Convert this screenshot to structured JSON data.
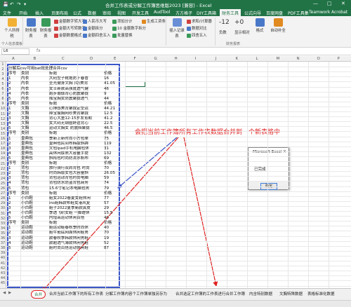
{
  "window": {
    "title": "合并工作表或分解工作簿思维版2023 [兼容] - Excel",
    "controls": [
      "—",
      "□",
      "✕"
    ]
  },
  "qat": [
    "💾",
    "↶",
    "↷",
    "▾"
  ],
  "ribbon_tabs": [
    "文件",
    "开始",
    "插入",
    "页面布局",
    "公式",
    "数据",
    "审阅",
    "视图",
    "开发工具",
    "AudTool",
    "方方格子",
    "DIY工具箱",
    "财务工具",
    "公式向导",
    "百度网盘",
    "PDF工具集",
    "Teamwork",
    "Acrobat",
    "WPS",
    "搜索"
  ],
  "ribbon": {
    "group1": {
      "label": "个人信息模板",
      "big": "个人所得税"
    },
    "group2_big": [
      "财务报表",
      "财务报表"
    ],
    "group2_small": [
      "金额数字转大写",
      "金额大写转数字",
      "金额数据格式"
    ],
    "group3_small": [
      "人民币大写",
      "金额拆分",
      "金额四舍五入"
    ],
    "group4_small": [
      "添加分计",
      "10 金额数字拆分",
      "批量替换"
    ],
    "group5_small": [
      "生成工资条",
      "",
      ""
    ],
    "group6_small": [
      "求和/计算器",
      "数据对比",
      "四舍五入"
    ],
    "group6_big": "插入记录表",
    "group7": [
      "-12",
      "+0",
      "负数",
      "显示相对"
    ],
    "group7_label": "财务报表",
    "group8": [
      "格式",
      "自动补全"
    ]
  },
  "formula_bar": {
    "name_box": "L6",
    "content": ""
  },
  "columns": [
    "A",
    "B",
    "C",
    "D",
    "E",
    "F",
    "G",
    "H",
    "I",
    "J",
    "K",
    "L",
    "M",
    "N",
    "O",
    "P",
    "Q",
    "R",
    "S"
  ],
  "row_numbers": [
    "1",
    "2",
    "3",
    "4",
    "5",
    "6",
    "7",
    "8",
    "9",
    "10",
    "11",
    "12",
    "13",
    "14",
    "15",
    "16",
    "17",
    "18",
    "19",
    "20",
    "21",
    "22",
    "23",
    "24",
    "25",
    "26",
    "27",
    "28",
    "29",
    "30",
    "31",
    "32",
    "33",
    "34",
    "35",
    "36",
    "37",
    "38",
    "39",
    "40",
    "41",
    "42",
    "43",
    "44",
    "45"
  ],
  "sheet_rows": [
    [
      "",
      "",
      "",
      ""
    ],
    [
      "分解后csv可用bat批处理合并csv",
      "",
      "",
      ""
    ],
    [
      "序号",
      "类别",
      "标题",
      "价格"
    ],
    [
      "1",
      "内衣",
      "大码型子靴拖防下春冒",
      "16"
    ],
    [
      "2",
      "内衣",
      "圣光健身文胸 (Q)美背",
      "41.05"
    ],
    [
      "3",
      "内衣",
      "女士新款高强度透气健",
      "46"
    ],
    [
      "4",
      "内衣",
      "跑步瑜伽背心防震聚拢",
      "9"
    ],
    [
      "5",
      "内衣",
      "咖宝胸女防震聚拢透气",
      "44"
    ],
    [
      "序号",
      "类别",
      "标题",
      "价格"
    ],
    [
      "1",
      "文胸",
      "心博感美背聚拢定型运",
      "44.21"
    ],
    [
      "2",
      "文胸",
      "绰宝瘦胸网纱美背聚拢",
      "12.5"
    ],
    [
      "3",
      "文胸",
      "背心大童12-15岁发育期",
      "41.2"
    ],
    [
      "4",
      "文胸",
      "女大码无钢圈舒适背心",
      "22.5"
    ],
    [
      "5",
      "文胸",
      "运动文胸女 防震挡聚拢",
      "46.5"
    ],
    [
      "序号",
      "类别",
      "标题",
      "价格"
    ],
    [
      "1",
      "皇典包",
      "季新上新时尚小方包单",
      "75"
    ],
    [
      "2",
      "皇典包",
      "皇典包民间布韩版斜跨",
      "119"
    ],
    [
      "3",
      "皇典包",
      "文包ipad手机电脑包休",
      "31"
    ],
    [
      "4",
      "皇典包",
      "高休闲厚质大容量手提",
      "132"
    ],
    [
      "5",
      "皇典包",
      "斜挎包时尚防泼水帆布",
      "69"
    ],
    [
      "序号",
      "类别",
      "标题",
      "价格"
    ],
    [
      "1",
      "背包",
      "旅行骑行双肩背包 时尚",
      "70"
    ],
    [
      "2",
      "背包",
      "时尚韩版女包大容量斜",
      "26.05"
    ],
    [
      "3",
      "背包",
      "背包运动背包时尚电脑",
      "59"
    ],
    [
      "4",
      "背包",
      "背包防水防盗背包商务",
      "74"
    ],
    [
      "5",
      "背包",
      "15.6寸笔记本电脑包男",
      "79"
    ],
    [
      "序号",
      "类别",
      "标题",
      "价格"
    ],
    [
      "1",
      "小白鞋",
      "鞋女2022春夏女鞋休闲",
      "77"
    ],
    [
      "2",
      "小白鞋",
      "ins鞋韩款布鞋女港风复",
      "57"
    ],
    [
      "3",
      "小白鞋",
      "鞋子2022夏季新款真皮",
      "29"
    ],
    [
      "4",
      "小白鞋",
      "季透飞织女鞋 一脚蹬休",
      "15.5"
    ],
    [
      "5",
      "小白鞋",
      "内增高运动休闲百搭",
      "40"
    ],
    [
      "序号",
      "类别",
      "标题",
      "价格"
    ],
    [
      "1",
      "运动鞋",
      "鞋运动鞋春秋季时尚休",
      "40"
    ],
    [
      "2",
      "运动鞋",
      "鞋牛筋底网面休闲鞋男",
      "70"
    ],
    [
      "3",
      "运动鞋",
      "款春秋季韩款休闲男鞋",
      "19"
    ],
    [
      "4",
      "运动鞋",
      "款超透气薄款休闲男鞋",
      "52"
    ],
    [
      "5",
      "运动鞋",
      "鞋时尚百搭运动休闲鞋",
      "87"
    ]
  ],
  "annotation": "会把当前工作簿所有工作表数据合并到一个新表格中",
  "msgbox": {
    "title": "Microsoft Excel",
    "close": "✕",
    "message": "已完成",
    "ok": "确定"
  },
  "sheet_tabs": [
    "合并",
    "合并当前工作簿下的所有工作表",
    "分解工作簿内容个工作簿单独另存为",
    "合并选定工作簿的工作表进行合并工作簿",
    "内含特别数据",
    "文胸特殊数据",
    "表格标准化数据"
  ],
  "active_sheet": "合并",
  "colors": {
    "excel_green": "#217346",
    "annotation_red": "#e02020",
    "box_blue": "#3b56c8"
  }
}
